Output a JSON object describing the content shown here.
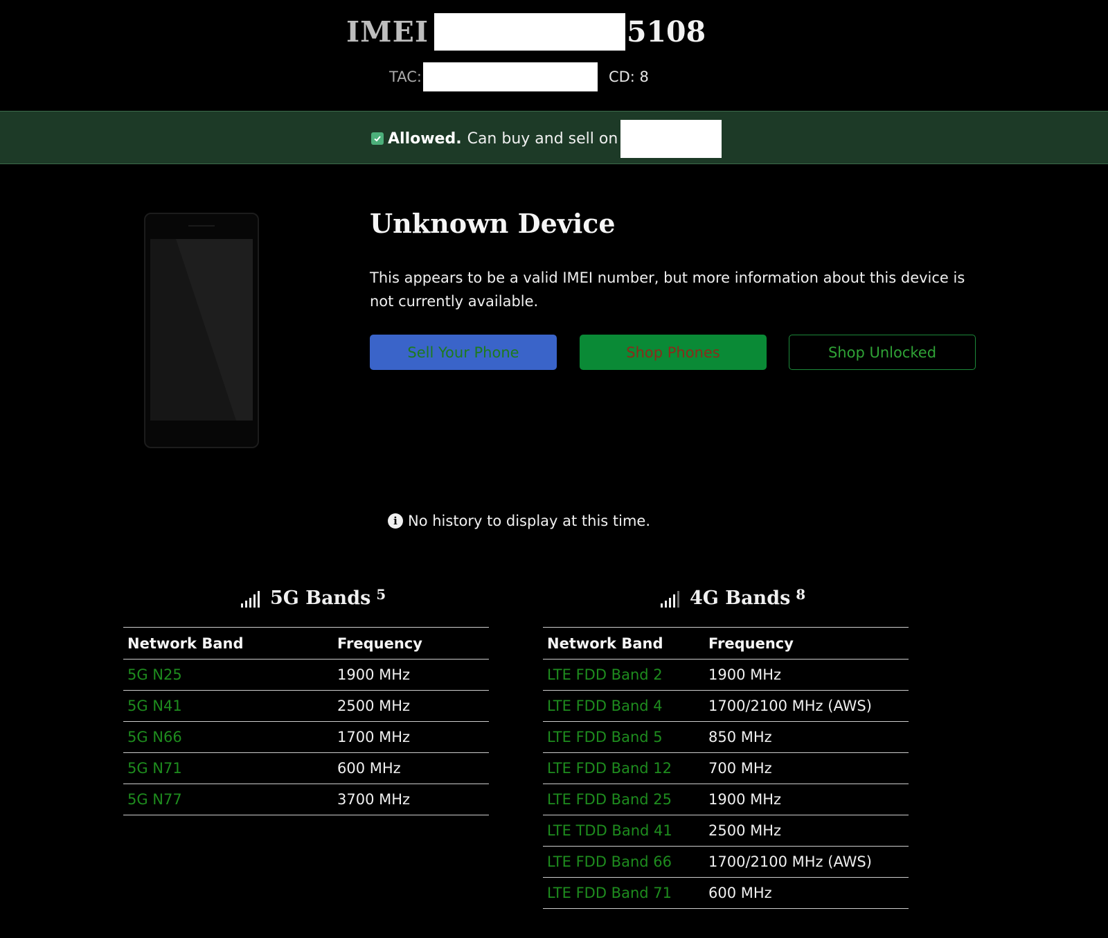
{
  "header": {
    "imei_label": "IMEI",
    "imei_suffix": "5108",
    "tac_label": "TAC:",
    "cd_text": "CD: 8"
  },
  "status": {
    "strong": "Allowed.",
    "text": "Can buy and sell on"
  },
  "device": {
    "title": "Unknown Device",
    "description": "This appears to be a valid IMEI number, but more information about this device is not currently available."
  },
  "buttons": {
    "sell": "Sell Your Phone",
    "shop": "Shop Phones",
    "unlocked": "Shop Unlocked"
  },
  "history": {
    "text": "No history to display at this time."
  },
  "bands5g": {
    "title": "5G Bands",
    "count": "5",
    "col_band": "Network Band",
    "col_freq": "Frequency",
    "rows": [
      {
        "band": "5G N25",
        "freq": "1900 MHz"
      },
      {
        "band": "5G N41",
        "freq": "2500 MHz"
      },
      {
        "band": "5G N66",
        "freq": "1700 MHz"
      },
      {
        "band": "5G N71",
        "freq": "600 MHz"
      },
      {
        "band": "5G N77",
        "freq": "3700 MHz"
      }
    ]
  },
  "bands4g": {
    "title": "4G Bands",
    "count": "8",
    "col_band": "Network Band",
    "col_freq": "Frequency",
    "rows": [
      {
        "band": "LTE FDD Band 2",
        "freq": "1900 MHz"
      },
      {
        "band": "LTE FDD Band 4",
        "freq": "1700/2100 MHz (AWS)"
      },
      {
        "band": "LTE FDD Band 5",
        "freq": "850 MHz"
      },
      {
        "band": "LTE FDD Band 12",
        "freq": "700 MHz"
      },
      {
        "band": "LTE FDD Band 25",
        "freq": "1900 MHz"
      },
      {
        "band": "LTE TDD Band 41",
        "freq": "2500 MHz"
      },
      {
        "band": "LTE FDD Band 66",
        "freq": "1700/2100 MHz (AWS)"
      },
      {
        "band": "LTE FDD Band 71",
        "freq": "600 MHz"
      }
    ]
  }
}
